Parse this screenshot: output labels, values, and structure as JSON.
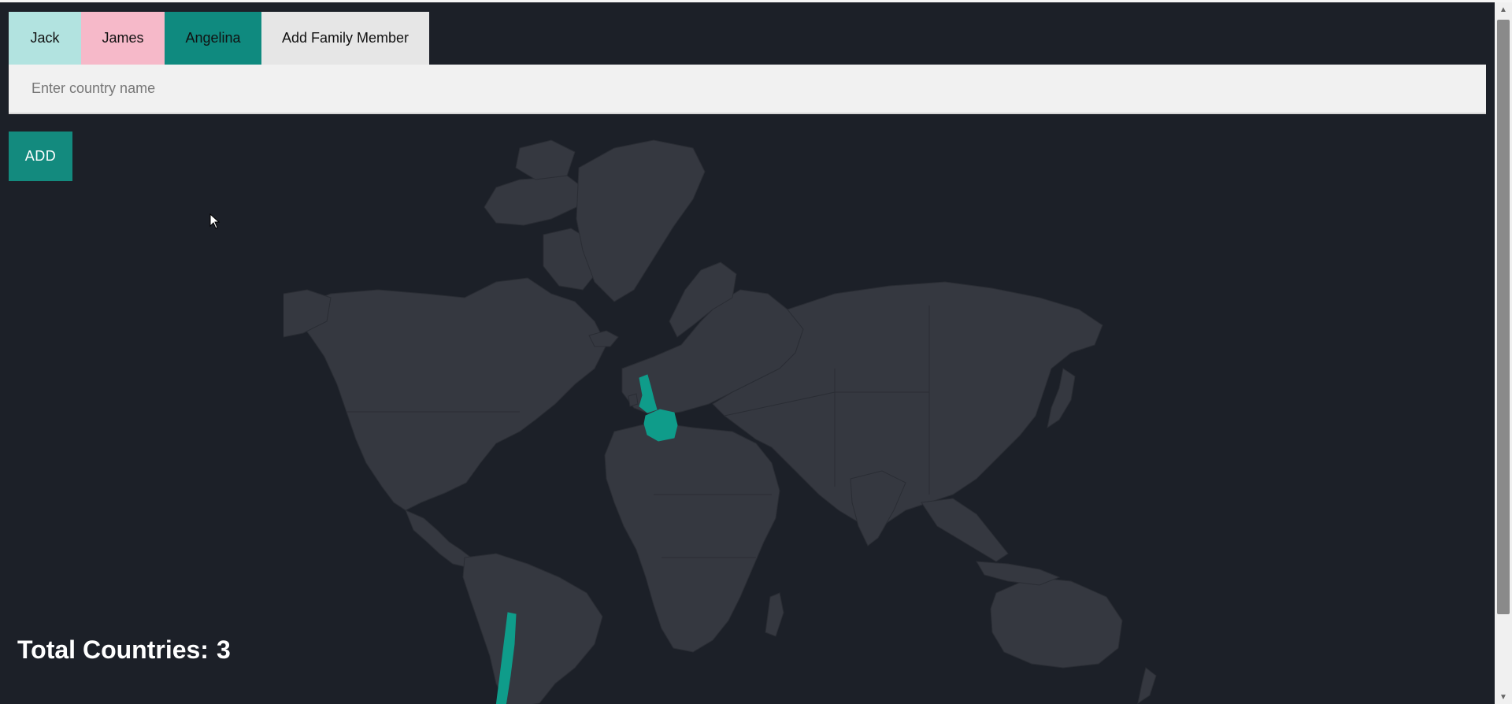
{
  "tabs": [
    {
      "label": "Jack",
      "color": "#b2e3e0"
    },
    {
      "label": "James",
      "color": "#f6b9c9"
    },
    {
      "label": "Angelina",
      "color": "#0f8a7f"
    },
    {
      "label": "Add Family Member",
      "color": "#e6e6e6"
    }
  ],
  "search": {
    "placeholder": "Enter country name",
    "value": ""
  },
  "add_button": {
    "label": "ADD"
  },
  "map": {
    "land_color": "#353840",
    "highlight_color": "#0f9c8a",
    "highlighted_countries": [
      "United Kingdom",
      "France",
      "Chile"
    ]
  },
  "summary": {
    "total_label": "Total Countries:",
    "total_value": "3"
  },
  "icons": [
    "cursor-arrow-icon",
    "scroll-up-icon",
    "scroll-down-icon"
  ]
}
